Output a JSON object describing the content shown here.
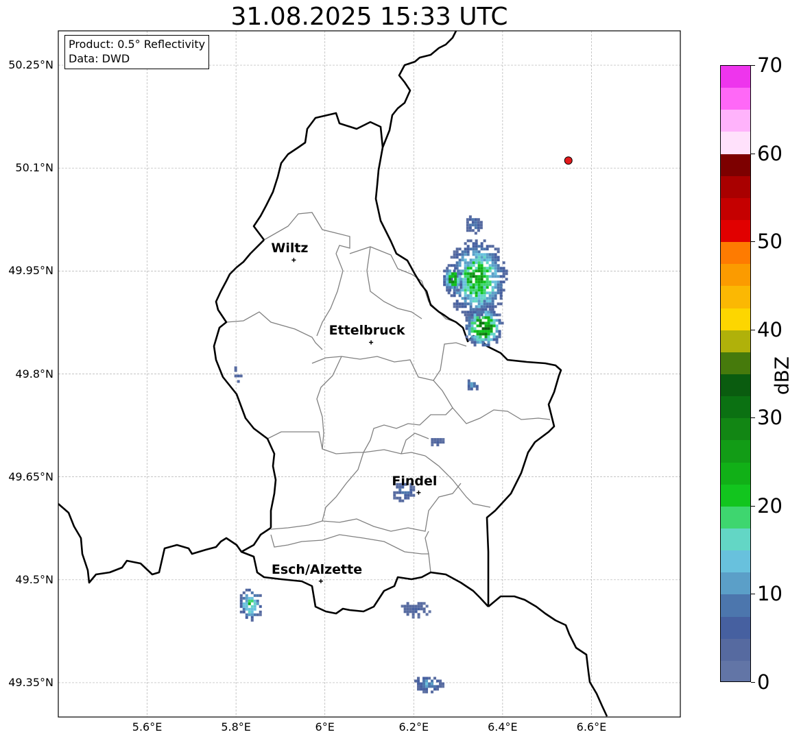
{
  "title": "31.08.2025 15:33 UTC",
  "info_box": {
    "product": "Product: 0.5° Reflectivity",
    "data_source": "Data: DWD"
  },
  "extent": {
    "lon_min": 5.4,
    "lon_max": 6.8,
    "lat_min": 49.3,
    "lat_max": 50.3
  },
  "lat_ticks": [
    {
      "value": 50.25,
      "label": "50.25°N"
    },
    {
      "value": 50.1,
      "label": "50.1°N"
    },
    {
      "value": 49.95,
      "label": "49.95°N"
    },
    {
      "value": 49.8,
      "label": "49.8°N"
    },
    {
      "value": 49.65,
      "label": "49.65°N"
    },
    {
      "value": 49.5,
      "label": "49.5°N"
    },
    {
      "value": 49.35,
      "label": "49.35°N"
    }
  ],
  "lon_ticks": [
    {
      "value": 5.6,
      "label": "5.6°E"
    },
    {
      "value": 5.8,
      "label": "5.8°E"
    },
    {
      "value": 6.0,
      "label": "6°E"
    },
    {
      "value": 6.2,
      "label": "6.2°E"
    },
    {
      "value": 6.4,
      "label": "6.4°E"
    },
    {
      "value": 6.6,
      "label": "6.6°E"
    }
  ],
  "cities": [
    {
      "name": "Wiltz",
      "lon": 5.93,
      "lat": 49.966
    },
    {
      "name": "Ettelbruck",
      "lon": 6.104,
      "lat": 49.846
    },
    {
      "name": "Findel",
      "lon": 6.211,
      "lat": 49.627
    },
    {
      "name": "Esch/Alzette",
      "lon": 5.991,
      "lat": 49.498
    }
  ],
  "radar_site": {
    "lon": 6.548,
    "lat": 50.111,
    "color": "#e31a1c"
  },
  "colorbar": {
    "label": "dBZ",
    "ticks": [
      "0",
      "10",
      "20",
      "30",
      "40",
      "50",
      "60",
      "70"
    ],
    "min": 0,
    "max": 70,
    "colors": [
      "#6275a6",
      "#566aa0",
      "#4660a0",
      "#4c76ad",
      "#5b9fc8",
      "#68c1dd",
      "#63d6c5",
      "#3ed66f",
      "#12c51e",
      "#11b017",
      "#129c16",
      "#128614",
      "#0b7112",
      "#0a5c0f",
      "#467a0c",
      "#b0b10a",
      "#fdd600",
      "#fbb803",
      "#fb9b00",
      "#fe7b01",
      "#e10000",
      "#c50000",
      "#a90000",
      "#7d0000",
      "#ffe1fb",
      "#ffb3fb",
      "#ff68f7",
      "#ee35ed"
    ]
  },
  "radar_cells": [
    {
      "lon": 6.34,
      "lat": 49.94,
      "dlon": 0.14,
      "dlat": 0.12,
      "max_dbz": 32
    },
    {
      "lon": 6.355,
      "lat": 49.87,
      "dlon": 0.09,
      "dlat": 0.06,
      "max_dbz": 42
    },
    {
      "lon": 6.332,
      "lat": 50.02,
      "dlon": 0.04,
      "dlat": 0.03,
      "max_dbz": 12
    },
    {
      "lon": 6.285,
      "lat": 49.94,
      "dlon": 0.05,
      "dlat": 0.04,
      "max_dbz": 35
    },
    {
      "lon": 5.8,
      "lat": 49.8,
      "dlon": 0.02,
      "dlat": 0.03,
      "max_dbz": 8
    },
    {
      "lon": 6.33,
      "lat": 49.786,
      "dlon": 0.03,
      "dlat": 0.02,
      "max_dbz": 17
    },
    {
      "lon": 6.25,
      "lat": 49.703,
      "dlon": 0.035,
      "dlat": 0.015,
      "max_dbz": 6
    },
    {
      "lon": 6.175,
      "lat": 49.63,
      "dlon": 0.055,
      "dlat": 0.03,
      "max_dbz": 11
    },
    {
      "lon": 5.83,
      "lat": 49.466,
      "dlon": 0.055,
      "dlat": 0.05,
      "max_dbz": 25
    },
    {
      "lon": 6.2,
      "lat": 49.459,
      "dlon": 0.07,
      "dlat": 0.025,
      "max_dbz": 6
    },
    {
      "lon": 6.23,
      "lat": 49.35,
      "dlon": 0.07,
      "dlat": 0.025,
      "max_dbz": 16
    }
  ]
}
